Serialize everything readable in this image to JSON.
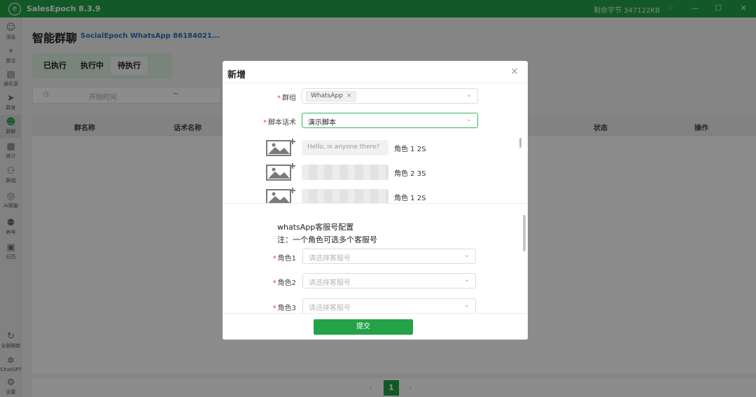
{
  "app": {
    "title": "SalesEpoch 8.3.9",
    "logo_glyph": "e",
    "storage_text": "剩余字节 347122KB",
    "brand_color": "#23a247"
  },
  "window_controls": {
    "bell": "♢",
    "minimize": "—",
    "maximize": "☐",
    "close": "✕"
  },
  "sidebar": {
    "items": [
      {
        "label": "消息",
        "icon": "message-icon",
        "glyph": "☺"
      },
      {
        "label": "聚合",
        "icon": "aggregate-icon",
        "glyph": "⚬"
      },
      {
        "label": "通讯录",
        "icon": "contacts-icon",
        "glyph": "▤"
      },
      {
        "label": "群发",
        "icon": "send-icon",
        "glyph": "➤"
      },
      {
        "label": "群聊",
        "icon": "group-chat-icon",
        "glyph": "☻"
      },
      {
        "label": "统计",
        "icon": "stats-icon",
        "glyph": "▦"
      },
      {
        "label": "群组",
        "icon": "group-icon",
        "glyph": "⚇"
      },
      {
        "label": "AI客服",
        "icon": "ai-service-icon",
        "glyph": "◎"
      },
      {
        "label": "养号",
        "icon": "account-farm-icon",
        "glyph": "⚉"
      },
      {
        "label": "日历",
        "icon": "calendar-icon",
        "glyph": "▣"
      }
    ],
    "bottom_items": [
      {
        "label": "全部刷新",
        "icon": "refresh-icon",
        "glyph": "↻"
      },
      {
        "label": "ChatGPT",
        "icon": "chatgpt-icon",
        "glyph": "✲"
      },
      {
        "label": "设置",
        "icon": "settings-icon",
        "glyph": "⚙"
      }
    ]
  },
  "page": {
    "title": "智能群聊",
    "account": "SocialEpoch WhatsApp 86184021...",
    "tabs": [
      "已执行",
      "执行中",
      "待执行"
    ],
    "selected_tab": "待执行",
    "filter": {
      "placeholder": "开始时间",
      "separator": "~"
    },
    "table_headers": [
      "群名称",
      "话术名称",
      "状态",
      "操作"
    ],
    "pagination": {
      "prev": "‹",
      "current": "1",
      "next": "›"
    }
  },
  "modal": {
    "title": "新增",
    "close": "×",
    "group_label": "群组",
    "group_tag": "WhatsApp",
    "group_tag_remove": "×",
    "script_label": "脚本话术",
    "script_value": "演示脚本",
    "script_rows": [
      {
        "text": "Hello, is anyone there?",
        "role": "角色 1",
        "delay": "2S"
      },
      {
        "text": "",
        "role": "角色 2",
        "delay": "3S"
      },
      {
        "text": "",
        "role": "角色 1",
        "delay": "2S"
      }
    ],
    "config_title": "whatsApp客服号配置",
    "config_note": "注：一个角色可选多个客服号",
    "roles": [
      {
        "label": "角色1",
        "placeholder": "请选择客服号"
      },
      {
        "label": "角色2",
        "placeholder": "请选择客服号"
      },
      {
        "label": "角色3",
        "placeholder": "请选择客服号"
      }
    ],
    "submit": "提交"
  }
}
